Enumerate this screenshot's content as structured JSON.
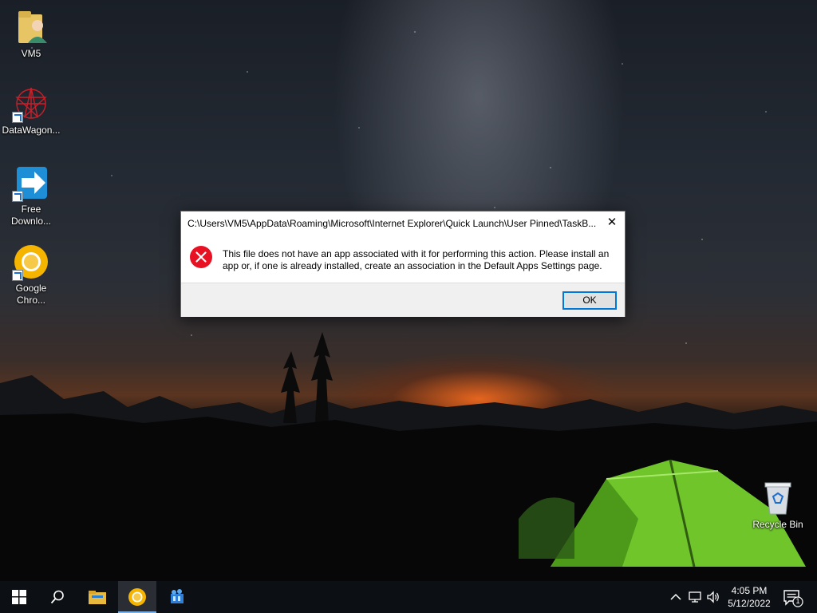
{
  "desktop": {
    "icons": [
      {
        "label": "VM5",
        "icon": "user-folder-icon"
      },
      {
        "label": "DataWagon...",
        "icon": "datawagon-icon"
      },
      {
        "label": "Free Downlo...",
        "icon": "free-download-manager-icon"
      },
      {
        "label": "Google Chro...",
        "icon": "chrome-icon"
      },
      {
        "label": "Recycle Bin",
        "icon": "recycle-bin-icon"
      }
    ]
  },
  "dialog": {
    "title": "C:\\Users\\VM5\\AppData\\Roaming\\Microsoft\\Internet Explorer\\Quick Launch\\User Pinned\\TaskB...",
    "close_label": "✕",
    "message": "This file does not have an app associated with it for performing this action. Please install an app or, if one is already installed, create an association in the Default Apps Settings page.",
    "ok_label": "OK",
    "icon": "error-icon"
  },
  "taskbar": {
    "items": [
      "start-icon",
      "search-icon",
      "file-explorer-icon",
      "chrome-icon",
      "datawagon-icon"
    ],
    "clock": {
      "time": "4:05 PM",
      "date": "5/12/2022"
    },
    "notification_count": "1",
    "tray": [
      "chevron-up-icon",
      "network-icon",
      "volume-icon"
    ]
  },
  "colors": {
    "accent": "#0078d7",
    "error": "#e81123",
    "taskbar": "#0c0f14"
  }
}
